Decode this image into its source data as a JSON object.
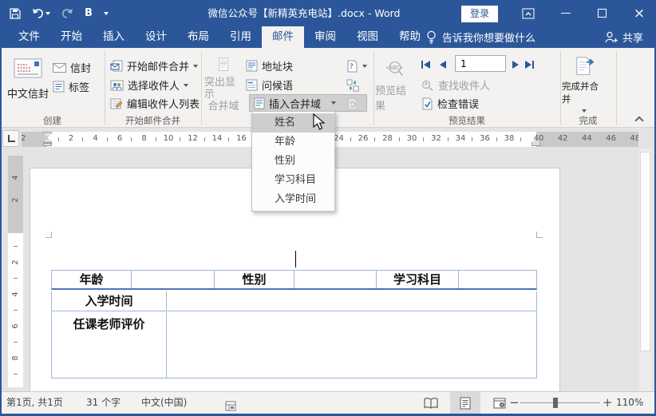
{
  "colors": {
    "accent": "#2b579a",
    "ribbon_bg": "#f3f2f1",
    "table_border": "#9fb6d9",
    "table_header_border": "#4e74b6",
    "menu_highlight": "#d0cecc"
  },
  "title_bar": {
    "title": "微信公众号【新精英充电站】.docx - Word",
    "sign_in": "登录",
    "bold_button": "B"
  },
  "tabs": [
    "文件",
    "开始",
    "插入",
    "设计",
    "布局",
    "引用",
    "邮件",
    "审阅",
    "视图",
    "帮助"
  ],
  "tell_me": "告诉我你想要做什么",
  "share_label": "共享",
  "ribbon": {
    "create": {
      "chinese_envelope": "中文信封",
      "envelopes": "信封",
      "labels": "标签",
      "group_label": "创建"
    },
    "start_merge": {
      "start_mail_merge": "开始邮件合并",
      "select_recipients": "选择收件人",
      "edit_recipient_list": "编辑收件人列表",
      "group_label": "开始邮件合并"
    },
    "write_insert": {
      "highlight_line1": "突出显示",
      "highlight_line2": "合并域",
      "address_block": "地址块",
      "greeting_line": "问候语",
      "insert_merge_field": "插入合并域"
    },
    "preview": {
      "preview_results_button": "预览结果",
      "record_value": "1",
      "find_recipient": "查找收件人",
      "check_errors": "检查错误",
      "group_label": "预览结果"
    },
    "finish": {
      "finish_merge": "完成并合并",
      "group_label": "完成"
    }
  },
  "merge_field_menu": {
    "items": [
      "姓名",
      "年龄",
      "性别",
      "学习科目",
      "入学时间"
    ],
    "highlighted": "姓名"
  },
  "ruler": {
    "h_gray_left": [
      "2"
    ],
    "h_white": [
      "2",
      "4",
      "6",
      "8",
      "10",
      "12",
      "14",
      "16",
      "18",
      "20",
      "22",
      "24",
      "26",
      "28",
      "30",
      "32",
      "34",
      "36",
      "38"
    ],
    "h_gray_right": [
      "40",
      "42",
      "44",
      "46",
      "48"
    ],
    "v_gray": [
      "4",
      "2"
    ],
    "v_white": [
      "2",
      "4",
      "6",
      "8"
    ]
  },
  "document": {
    "table": {
      "r1c1": "年龄",
      "r1c3": "性别",
      "r1c5": "学习科目",
      "r2c1": "入学时间",
      "r3c1": "任课老师评价"
    }
  },
  "status_bar": {
    "page_info": "第1页, 共1页",
    "word_count": "31 个字",
    "language": "中文(中国)",
    "zoom_level": "110%"
  }
}
